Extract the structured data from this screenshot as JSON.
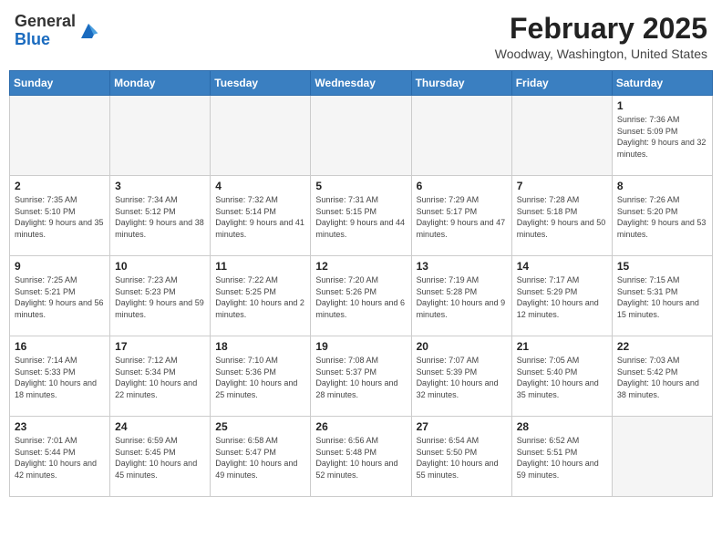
{
  "header": {
    "logo_general": "General",
    "logo_blue": "Blue",
    "month_title": "February 2025",
    "location": "Woodway, Washington, United States"
  },
  "weekdays": [
    "Sunday",
    "Monday",
    "Tuesday",
    "Wednesday",
    "Thursday",
    "Friday",
    "Saturday"
  ],
  "weeks": [
    [
      {
        "day": "",
        "info": ""
      },
      {
        "day": "",
        "info": ""
      },
      {
        "day": "",
        "info": ""
      },
      {
        "day": "",
        "info": ""
      },
      {
        "day": "",
        "info": ""
      },
      {
        "day": "",
        "info": ""
      },
      {
        "day": "1",
        "info": "Sunrise: 7:36 AM\nSunset: 5:09 PM\nDaylight: 9 hours and 32 minutes."
      }
    ],
    [
      {
        "day": "2",
        "info": "Sunrise: 7:35 AM\nSunset: 5:10 PM\nDaylight: 9 hours and 35 minutes."
      },
      {
        "day": "3",
        "info": "Sunrise: 7:34 AM\nSunset: 5:12 PM\nDaylight: 9 hours and 38 minutes."
      },
      {
        "day": "4",
        "info": "Sunrise: 7:32 AM\nSunset: 5:14 PM\nDaylight: 9 hours and 41 minutes."
      },
      {
        "day": "5",
        "info": "Sunrise: 7:31 AM\nSunset: 5:15 PM\nDaylight: 9 hours and 44 minutes."
      },
      {
        "day": "6",
        "info": "Sunrise: 7:29 AM\nSunset: 5:17 PM\nDaylight: 9 hours and 47 minutes."
      },
      {
        "day": "7",
        "info": "Sunrise: 7:28 AM\nSunset: 5:18 PM\nDaylight: 9 hours and 50 minutes."
      },
      {
        "day": "8",
        "info": "Sunrise: 7:26 AM\nSunset: 5:20 PM\nDaylight: 9 hours and 53 minutes."
      }
    ],
    [
      {
        "day": "9",
        "info": "Sunrise: 7:25 AM\nSunset: 5:21 PM\nDaylight: 9 hours and 56 minutes."
      },
      {
        "day": "10",
        "info": "Sunrise: 7:23 AM\nSunset: 5:23 PM\nDaylight: 9 hours and 59 minutes."
      },
      {
        "day": "11",
        "info": "Sunrise: 7:22 AM\nSunset: 5:25 PM\nDaylight: 10 hours and 2 minutes."
      },
      {
        "day": "12",
        "info": "Sunrise: 7:20 AM\nSunset: 5:26 PM\nDaylight: 10 hours and 6 minutes."
      },
      {
        "day": "13",
        "info": "Sunrise: 7:19 AM\nSunset: 5:28 PM\nDaylight: 10 hours and 9 minutes."
      },
      {
        "day": "14",
        "info": "Sunrise: 7:17 AM\nSunset: 5:29 PM\nDaylight: 10 hours and 12 minutes."
      },
      {
        "day": "15",
        "info": "Sunrise: 7:15 AM\nSunset: 5:31 PM\nDaylight: 10 hours and 15 minutes."
      }
    ],
    [
      {
        "day": "16",
        "info": "Sunrise: 7:14 AM\nSunset: 5:33 PM\nDaylight: 10 hours and 18 minutes."
      },
      {
        "day": "17",
        "info": "Sunrise: 7:12 AM\nSunset: 5:34 PM\nDaylight: 10 hours and 22 minutes."
      },
      {
        "day": "18",
        "info": "Sunrise: 7:10 AM\nSunset: 5:36 PM\nDaylight: 10 hours and 25 minutes."
      },
      {
        "day": "19",
        "info": "Sunrise: 7:08 AM\nSunset: 5:37 PM\nDaylight: 10 hours and 28 minutes."
      },
      {
        "day": "20",
        "info": "Sunrise: 7:07 AM\nSunset: 5:39 PM\nDaylight: 10 hours and 32 minutes."
      },
      {
        "day": "21",
        "info": "Sunrise: 7:05 AM\nSunset: 5:40 PM\nDaylight: 10 hours and 35 minutes."
      },
      {
        "day": "22",
        "info": "Sunrise: 7:03 AM\nSunset: 5:42 PM\nDaylight: 10 hours and 38 minutes."
      }
    ],
    [
      {
        "day": "23",
        "info": "Sunrise: 7:01 AM\nSunset: 5:44 PM\nDaylight: 10 hours and 42 minutes."
      },
      {
        "day": "24",
        "info": "Sunrise: 6:59 AM\nSunset: 5:45 PM\nDaylight: 10 hours and 45 minutes."
      },
      {
        "day": "25",
        "info": "Sunrise: 6:58 AM\nSunset: 5:47 PM\nDaylight: 10 hours and 49 minutes."
      },
      {
        "day": "26",
        "info": "Sunrise: 6:56 AM\nSunset: 5:48 PM\nDaylight: 10 hours and 52 minutes."
      },
      {
        "day": "27",
        "info": "Sunrise: 6:54 AM\nSunset: 5:50 PM\nDaylight: 10 hours and 55 minutes."
      },
      {
        "day": "28",
        "info": "Sunrise: 6:52 AM\nSunset: 5:51 PM\nDaylight: 10 hours and 59 minutes."
      },
      {
        "day": "",
        "info": ""
      }
    ]
  ]
}
